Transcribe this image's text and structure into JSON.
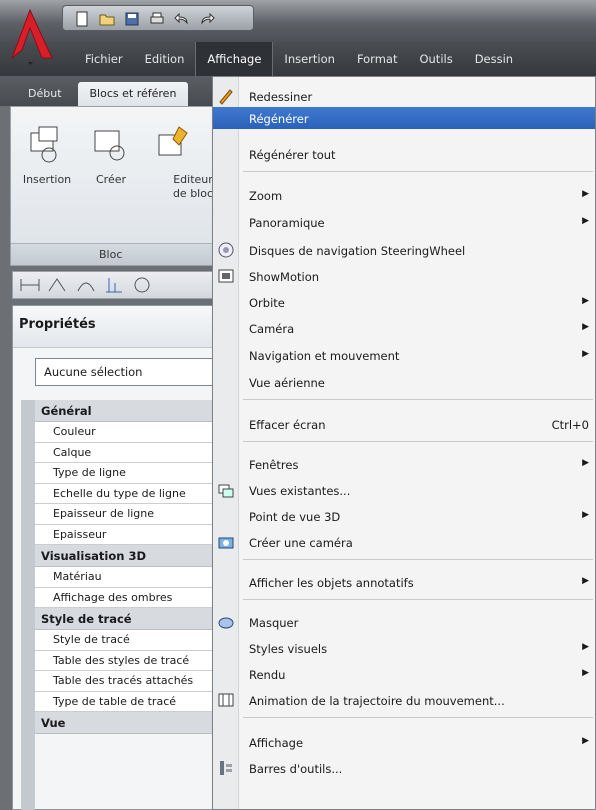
{
  "quick_access": {
    "icons": [
      "new-icon",
      "open-icon",
      "save-icon",
      "print-icon",
      "undo-icon",
      "redo-icon"
    ]
  },
  "menubar": {
    "items": [
      {
        "label": "Fichier"
      },
      {
        "label": "Edition"
      },
      {
        "label": "Affichage"
      },
      {
        "label": "Insertion"
      },
      {
        "label": "Format"
      },
      {
        "label": "Outils"
      },
      {
        "label": "Dessin"
      }
    ]
  },
  "ribbon": {
    "tabs": [
      {
        "label": "Début"
      },
      {
        "label": "Blocs et référen"
      }
    ],
    "buttons": [
      {
        "label": "Insertion"
      },
      {
        "label": "Créer"
      },
      {
        "label": "Editeur de bloc"
      }
    ],
    "panel_title": "Bloc"
  },
  "properties": {
    "title": "Propriétés",
    "selection": "Aucune sélection",
    "categories": [
      {
        "name": "Général",
        "rows": [
          "Couleur",
          "Calque",
          "Type de ligne",
          "Echelle du type de ligne",
          "Epaisseur de ligne",
          "Epaisseur"
        ]
      },
      {
        "name": "Visualisation 3D",
        "rows": [
          "Matériau",
          "Affichage des ombres"
        ]
      },
      {
        "name": "Style de tracé",
        "rows": [
          "Style de tracé",
          "Table des styles de tracé",
          "Table des tracés attachés",
          "Type de table de tracé"
        ]
      },
      {
        "name": "Vue",
        "rows": []
      }
    ]
  },
  "menu": {
    "items": [
      {
        "label": "Redessiner",
        "icon": "pencil-icon"
      },
      {
        "label": "Régénérer",
        "highlighted": true
      },
      {
        "label": "Régénérer tout"
      },
      {
        "label": "Zoom",
        "submenu": true
      },
      {
        "label": "Panoramique",
        "submenu": true
      },
      {
        "label": "Disques de navigation SteeringWheel",
        "icon": "steeringwheel-icon"
      },
      {
        "label": "ShowMotion",
        "icon": "showmotion-icon"
      },
      {
        "label": "Orbite",
        "submenu": true
      },
      {
        "label": "Caméra",
        "submenu": true
      },
      {
        "label": "Navigation et mouvement",
        "submenu": true
      },
      {
        "label": "Vue aérienne"
      },
      {
        "label": "Effacer écran",
        "shortcut": "Ctrl+0"
      },
      {
        "label": "Fenêtres",
        "submenu": true
      },
      {
        "label": "Vues existantes...",
        "icon": "named-views-icon"
      },
      {
        "label": "Point de vue 3D",
        "submenu": true
      },
      {
        "label": "Créer une caméra",
        "icon": "camera-icon"
      },
      {
        "label": "Afficher les objets annotatifs",
        "submenu": true
      },
      {
        "label": "Masquer",
        "icon": "hide-icon"
      },
      {
        "label": "Styles visuels",
        "submenu": true
      },
      {
        "label": "Rendu",
        "submenu": true
      },
      {
        "label": "Animation de la trajectoire du mouvement...",
        "icon": "animation-icon"
      },
      {
        "label": "Affichage",
        "submenu": true
      },
      {
        "label": "Barres d'outils...",
        "icon": "toolbars-icon"
      }
    ]
  }
}
